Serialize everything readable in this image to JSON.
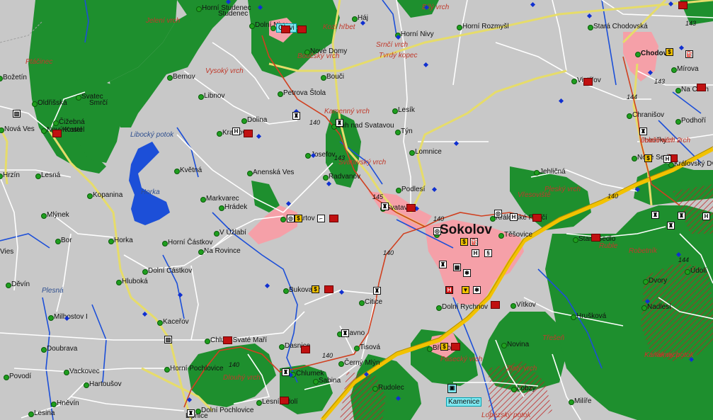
{
  "map": {
    "colors": {
      "background": "#c8c8c8",
      "forest": "#1e8f2e",
      "town": "#f5a0a8",
      "road_major": "#f2c200",
      "road_main": "#e6dc6a",
      "road_minor": "#ffffff",
      "rail": "#d04020",
      "water": "#1c4fd8",
      "reserve": "#c02020"
    },
    "towns": [
      {
        "name": "Horní Studenec"
      },
      {
        "name": "Studenec"
      },
      {
        "name": "Dolní Nivy"
      },
      {
        "name": "Olovi"
      },
      {
        "name": "Háj"
      },
      {
        "name": "Horní Nivy"
      },
      {
        "name": "Horní Rozmyšl"
      },
      {
        "name": "Stará Chodovská"
      },
      {
        "name": "Nové Domy"
      },
      {
        "name": "Bernov"
      },
      {
        "name": "Bouči"
      },
      {
        "name": "Petrova Štola"
      },
      {
        "name": "Libnov"
      },
      {
        "name": "Dolina"
      },
      {
        "name": "Luh nad Svatavou"
      },
      {
        "name": "Lesík"
      },
      {
        "name": "Týn"
      },
      {
        "name": "Kraikova"
      },
      {
        "name": "Josefov"
      },
      {
        "name": "Lomnice"
      },
      {
        "name": "Radvanov"
      },
      {
        "name": "Anenská Ves"
      },
      {
        "name": "Květná"
      },
      {
        "name": "Podlesí"
      },
      {
        "name": "Jehličná"
      },
      {
        "name": "Svatava"
      },
      {
        "name": "Markvarec"
      },
      {
        "name": "Hrádek"
      },
      {
        "name": "Habartov"
      },
      {
        "name": "Královské Poříčí"
      },
      {
        "name": "Sokolov"
      },
      {
        "name": "Těšovice"
      },
      {
        "name": "Staré Sedlo"
      },
      {
        "name": "V Úžlabí"
      },
      {
        "name": "Horní Částkov"
      },
      {
        "name": "Na Rovince"
      },
      {
        "name": "Dolní Částkov"
      },
      {
        "name": "Bukovany"
      },
      {
        "name": "Citice"
      },
      {
        "name": "Dolní Rychnov"
      },
      {
        "name": "Vítkov"
      },
      {
        "name": "Hlavno"
      },
      {
        "name": "Tisová"
      },
      {
        "name": "Hrušková"
      },
      {
        "name": "Chlum Svaté Maří"
      },
      {
        "name": "Dasnice"
      },
      {
        "name": "Březová"
      },
      {
        "name": "Novina"
      },
      {
        "name": "Černý Mlýn"
      },
      {
        "name": "Horní Pochlovice"
      },
      {
        "name": "Chlumek"
      },
      {
        "name": "Sabina"
      },
      {
        "name": "Rudolec"
      },
      {
        "name": "Lobzy"
      },
      {
        "name": "Kamenice"
      },
      {
        "name": "Dolní Pochlovice"
      },
      {
        "name": "Lipnice"
      },
      {
        "name": "Lesní Údolí"
      },
      {
        "name": "Milíře"
      },
      {
        "name": "Chodov"
      },
      {
        "name": "Mírova"
      },
      {
        "name": "Vintířov"
      },
      {
        "name": "Na Cech"
      },
      {
        "name": "Chranišov"
      },
      {
        "name": "Podhoří"
      },
      {
        "name": "Nové Sedlo"
      },
      {
        "name": "Loučky"
      },
      {
        "name": "Královský Dv"
      },
      {
        "name": "Údolí"
      },
      {
        "name": "Dvory"
      },
      {
        "name": "Nadlesí"
      },
      {
        "name": "Božetín"
      },
      {
        "name": "Oldřišská"
      },
      {
        "name": "Svatec"
      },
      {
        "name": "Smrčí"
      },
      {
        "name": "Nový Kostel"
      },
      {
        "name": "Čižebná"
      },
      {
        "name": "Nová Ves"
      },
      {
        "name": "Kostel"
      },
      {
        "name": "Hrzín"
      },
      {
        "name": "Lesná"
      },
      {
        "name": "Kopanina"
      },
      {
        "name": "Mlýnek"
      },
      {
        "name": "Bor"
      },
      {
        "name": "Horka"
      },
      {
        "name": "Hluboká"
      },
      {
        "name": "Vies"
      },
      {
        "name": "Děvín"
      },
      {
        "name": "Milhostov I"
      },
      {
        "name": "Doubrava"
      },
      {
        "name": "Vackovec"
      },
      {
        "name": "Kaceřov"
      },
      {
        "name": "Hartoušov"
      },
      {
        "name": "Povodí"
      },
      {
        "name": "Hněvín"
      },
      {
        "name": "Lesina"
      }
    ],
    "hills": [
      "Jelení vrch",
      "Kozí hřbet",
      "Bílý vrch",
      "Srnčí vrch",
      "Tvrdý kopec",
      "Boučský vrch",
      "Ptáčinec",
      "Vysoký vrch",
      "Svatavský vrch",
      "Kamenný vrch",
      "Pleský vrch",
      "Vřesoviště",
      "Robetník",
      "Kaňák vrch",
      "Jelení vrch 2",
      "Třešeň",
      "Pasecký vrch",
      "Zlatý vrch",
      "Dlouhý vrch",
      "Lobezský potok",
      "Kamenný potok",
      "Loučeniční vrch",
      "Ruble"
    ],
    "water_labels": [
      "Libocký potok",
      "Horka",
      "Plesná"
    ],
    "road_numbers": [
      "143",
      "143",
      "144",
      "140",
      "145",
      "140",
      "140",
      "140",
      "140",
      "144",
      "143",
      "140"
    ]
  }
}
